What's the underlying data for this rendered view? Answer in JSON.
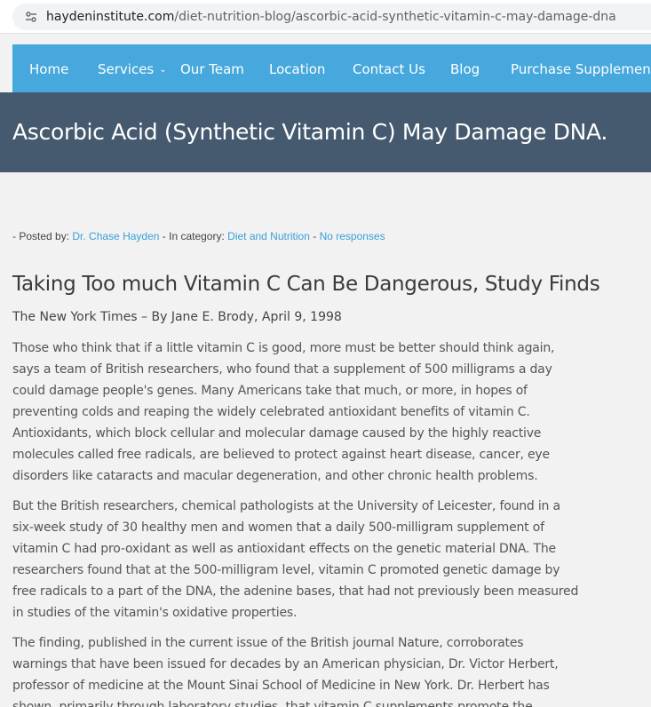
{
  "browser": {
    "url_domain": "haydeninstitute.com",
    "url_path": "/diet-nutrition-blog/ascorbic-acid-synthetic-vitamin-c-may-damage-dna",
    "site_info_icon": "tune-icon"
  },
  "nav": {
    "home": "Home",
    "services": "Services",
    "our_team": "Our Team",
    "location": "Location",
    "contact_us": "Contact Us",
    "blog": "Blog",
    "purchase": "Purchase Supplements"
  },
  "page": {
    "title": "Ascorbic Acid (Synthetic Vitamin C) May Damage DNA."
  },
  "meta": {
    "posted_by_prefix": "- Posted by:",
    "author": "Dr. Chase Hayden",
    "category_prefix": "- In category:",
    "category": "Diet and Nutrition",
    "separator": "-",
    "responses": "No responses"
  },
  "article": {
    "title": "Taking Too much Vitamin C Can Be Dangerous, Study Finds",
    "byline": "The New York Times – By Jane E. Brody, April 9, 1998",
    "p1": "Those who think that if a little vitamin C is good, more must be better should think again, says a team of British researchers, who found that a supplement of 500 milligrams a day could damage people's genes. Many Americans take that much, or more, in hopes of preventing colds and reaping the widely celebrated antioxidant benefits of vitamin C. Antioxidants, which block cellular and molecular damage caused by the highly reactive molecules called free radicals, are believed to protect against heart disease, cancer, eye disorders like cataracts and macular degeneration, and other chronic health problems.",
    "p2": "But the British researchers, chemical pathologists at the University of Leicester, found in a six-week study of 30 healthy men and women that a daily 500-milligram supplement of vitamin C had pro-oxidant as well as antioxidant effects on the genetic material DNA. The researchers found that at the 500-milligram level, vitamin C promoted genetic damage by free radicals to a part of the DNA, the adenine bases, that had not previously been measured in studies of the vitamin's oxidative properties.",
    "p3": "The finding, published in the current issue of the British journal Nature, corroborates warnings that have been issued for decades by an American physician, Dr. Victor Herbert, professor of medicine at the Mount Sinai School of Medicine in New York. Dr. Herbert has shown, primarily through laboratory studies, that vitamin C supplements promote the generation of free radicals from iron in"
  },
  "colors": {
    "nav_bg": "#46a8dc",
    "title_band_bg": "#455a6f",
    "link": "#3a9fd8",
    "page_bg": "#f2f2f2"
  }
}
